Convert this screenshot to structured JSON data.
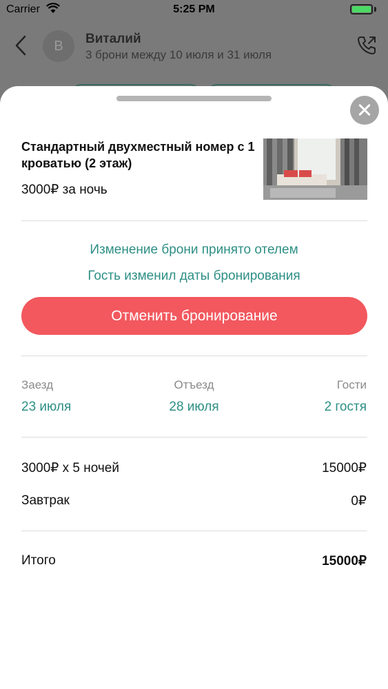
{
  "status_bar": {
    "carrier": "Carrier",
    "time": "5:25 PM"
  },
  "chat_header": {
    "avatar_letter": "В",
    "name": "Виталий",
    "subtitle": "3 брони между 10 июля и 31 июля"
  },
  "room": {
    "title": "Стандартный двухместный номер с 1 кроватью (2 этаж)",
    "price": "3000₽ за ночь"
  },
  "booking_status": {
    "line1": "Изменение брони принято отелем",
    "line2": "Гость изменил даты бронирования"
  },
  "cancel_button_label": "Отменить бронирование",
  "stay": {
    "checkin_label": "Заезд",
    "checkin_value": "23 июля",
    "checkout_label": "Отъезд",
    "checkout_value": "28 июля",
    "guests_label": "Гости",
    "guests_value": "2 гостя"
  },
  "pricing": {
    "nights_label": "3000₽ x 5 ночей",
    "nights_value": "15000₽",
    "breakfast_label": "Завтрак",
    "breakfast_value": "0₽",
    "total_label": "Итого",
    "total_value": "15000₽"
  },
  "colors": {
    "accent_teal": "#2e8f85",
    "cancel_red": "#f2585e",
    "battery_green": "#4cd964"
  }
}
